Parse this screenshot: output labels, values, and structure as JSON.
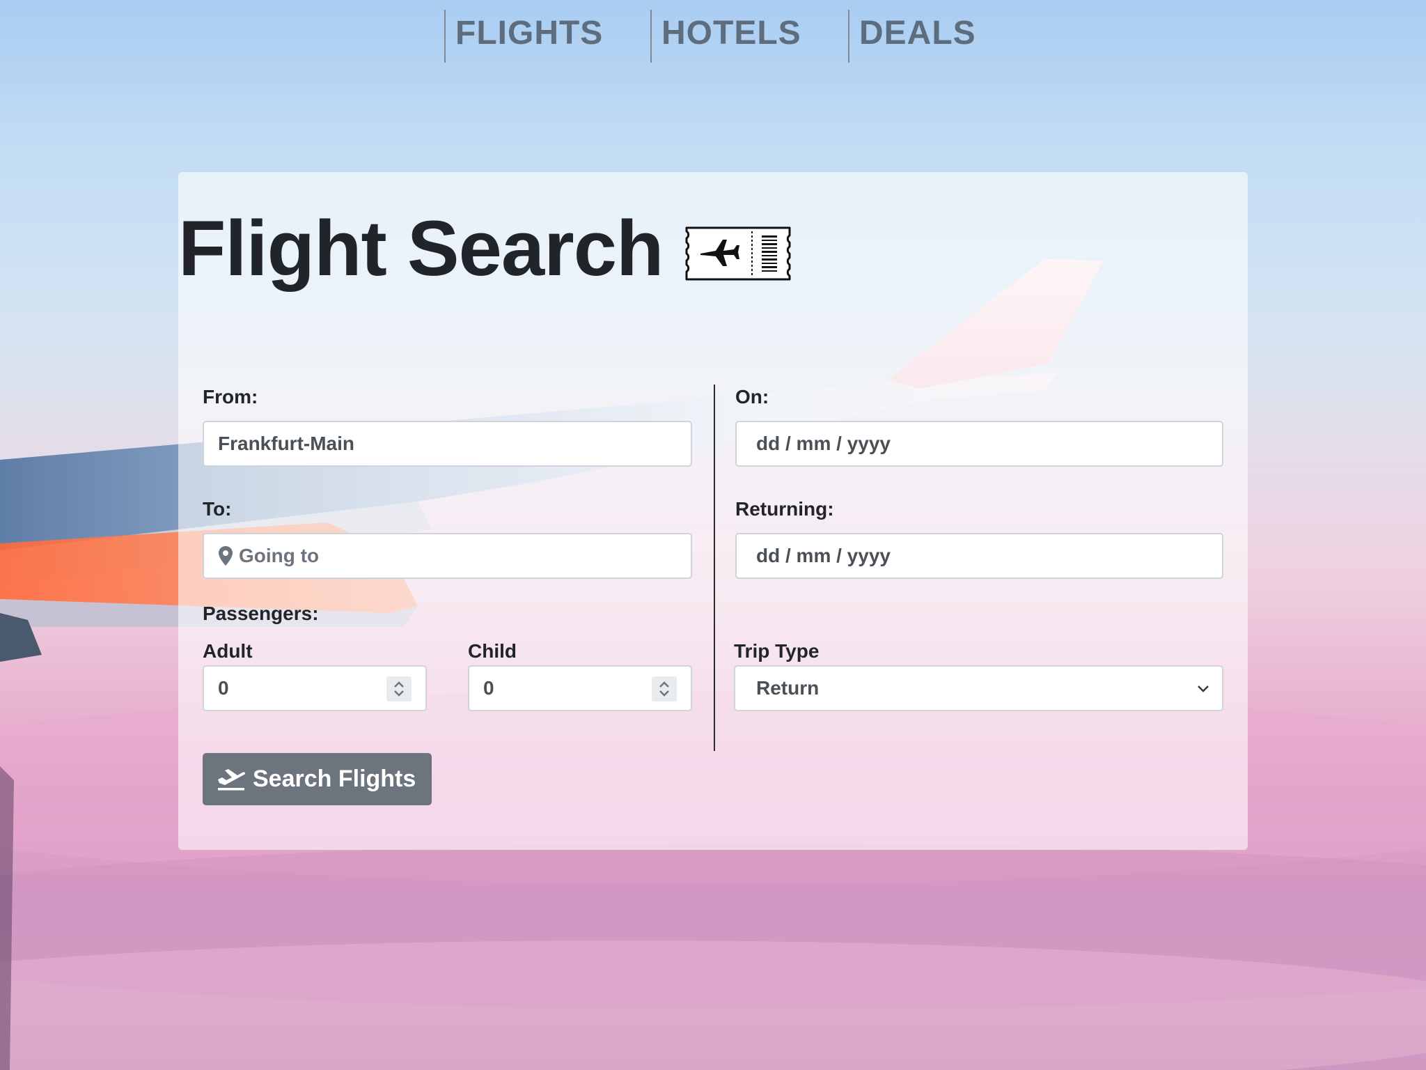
{
  "nav": {
    "items": [
      {
        "label": "FLIGHTS"
      },
      {
        "label": "HOTELS"
      },
      {
        "label": "DEALS"
      }
    ]
  },
  "search": {
    "title": "Flight Search",
    "from": {
      "label": "From:",
      "value": "Frankfurt-Main"
    },
    "to": {
      "label": "To:",
      "placeholder": "Going to"
    },
    "on": {
      "label": "On:",
      "placeholder": "dd / mm / yyyy"
    },
    "returning": {
      "label": "Returning:",
      "placeholder": "dd / mm / yyyy"
    },
    "passengers": {
      "label": "Passengers:",
      "adult": {
        "label": "Adult",
        "value": "0"
      },
      "child": {
        "label": "Child",
        "value": "0"
      }
    },
    "trip_type": {
      "label": "Trip Type",
      "value": "Return"
    },
    "submit_label": "Search Flights"
  },
  "colors": {
    "button_bg": "#6c757d",
    "nav_text": "#5d6d7d",
    "title_text": "#212529"
  },
  "icons": {
    "title": "ticket-icon",
    "to_field": "map-pin-icon",
    "button": "plane-takeoff-icon"
  }
}
